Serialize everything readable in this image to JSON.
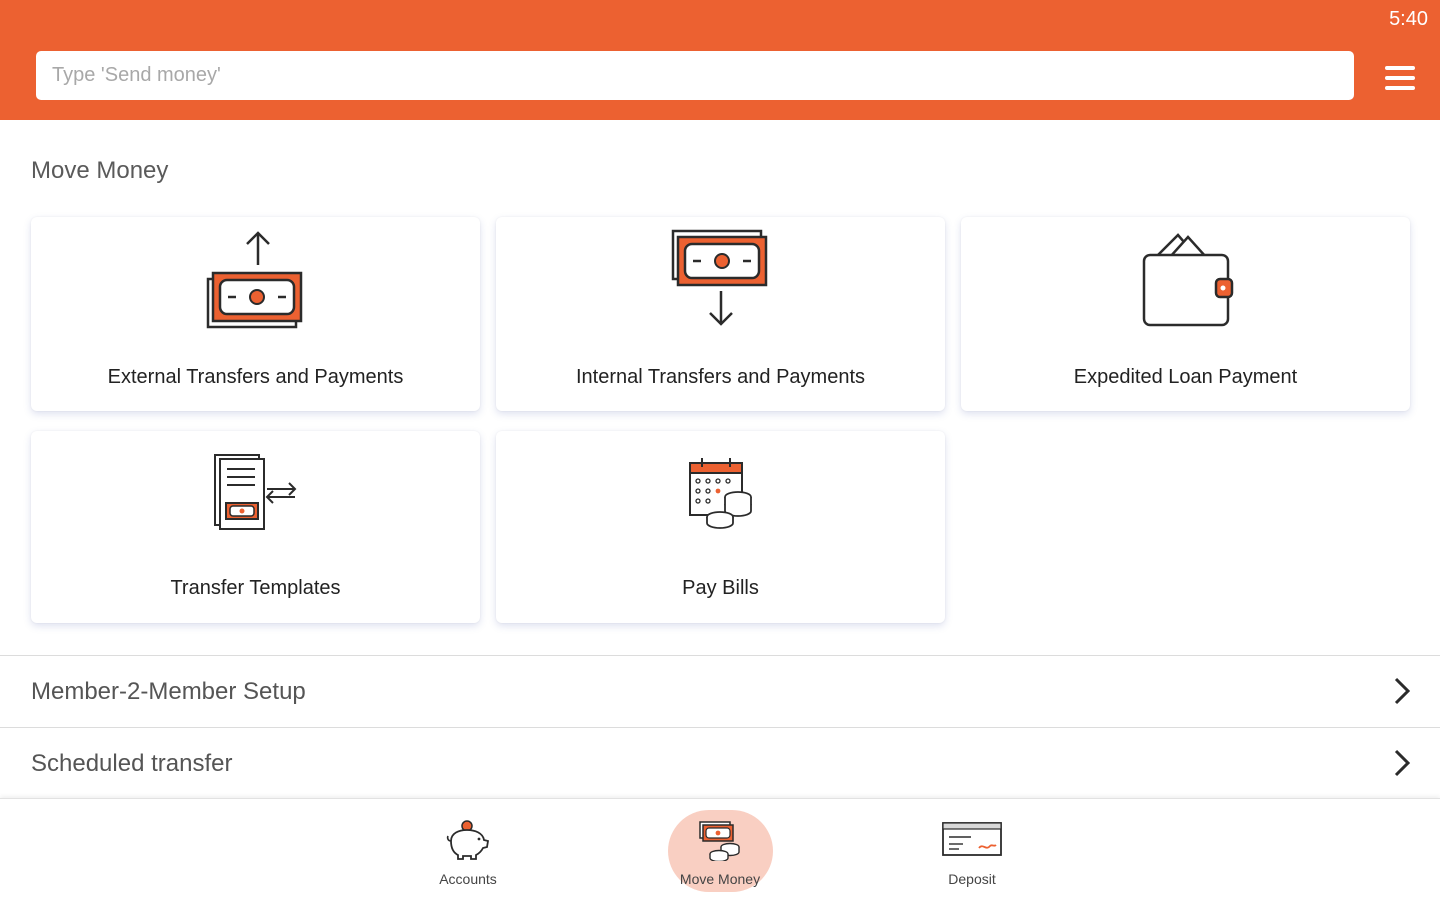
{
  "status_bar": {
    "time": "5:40"
  },
  "header": {
    "search_placeholder": "Type 'Send money'",
    "menu_icon": "hamburger-menu-icon"
  },
  "colors": {
    "brand": "#ec6131",
    "icon_dark": "#2b2b2b",
    "active_nav_bg": "#f9cfc2"
  },
  "main": {
    "section_title": "Move Money",
    "tiles": [
      {
        "label": "External Transfers and Payments",
        "icon": "send-money-out-icon"
      },
      {
        "label": "Internal Transfers and Payments",
        "icon": "receive-money-in-icon"
      },
      {
        "label": "Expedited Loan Payment",
        "icon": "wallet-icon"
      },
      {
        "label": "Transfer Templates",
        "icon": "transfer-template-icon"
      },
      {
        "label": "Pay Bills",
        "icon": "calendar-coins-icon"
      }
    ],
    "list_rows": [
      {
        "label": "Member-2-Member Setup",
        "icon": "chevron-right-icon"
      },
      {
        "label": "Scheduled transfer",
        "icon": "chevron-right-icon"
      }
    ]
  },
  "bottom_nav": {
    "items": [
      {
        "label": "Accounts",
        "icon": "piggy-bank-icon"
      },
      {
        "label": "Move Money",
        "icon": "move-money-icon"
      },
      {
        "label": "Deposit",
        "icon": "check-deposit-icon"
      }
    ],
    "active": "Move Money"
  }
}
